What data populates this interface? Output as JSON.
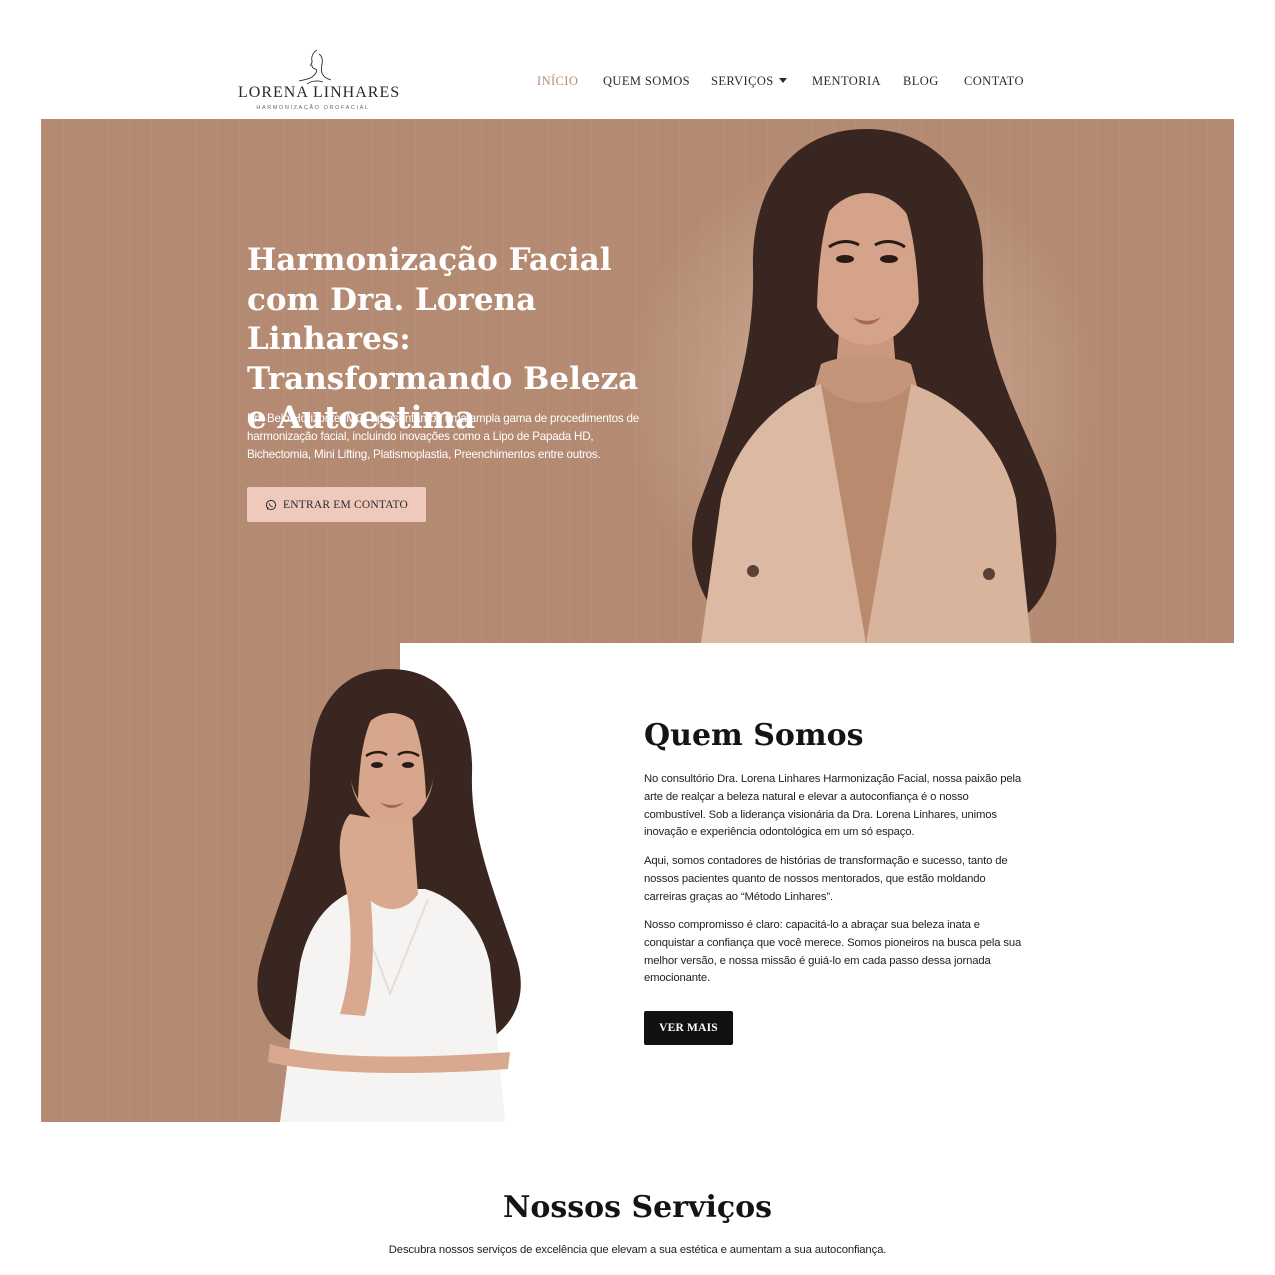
{
  "header": {
    "logo": {
      "name": "LORENA LINHARES",
      "tagline": "HARMONIZAÇÃO OROFACIAL",
      "icon": "face-line-art-logo"
    },
    "nav": [
      {
        "label": "INÍCIO",
        "active": true
      },
      {
        "label": "QUEM SOMOS",
        "active": false
      },
      {
        "label": "SERVIÇOS",
        "active": false,
        "has_dropdown": true
      },
      {
        "label": "MENTORIA",
        "active": false
      },
      {
        "label": "BLOG",
        "active": false
      },
      {
        "label": "CONTATO",
        "active": false
      }
    ]
  },
  "hero": {
    "title": "Harmonização Facial com Dra. Lorena Linhares: Transformando Beleza e Autoestima",
    "text": "Em Belo Horizonte, MG, apresentamos uma ampla gama de procedimentos de harmonização facial, incluindo inovações como a Lipo de Papada HD, Bichectomia, Mini Lifting, Platismoplastia, Preenchimentos entre outros.",
    "button_label": "ENTRAR EM CONTATO",
    "button_icon": "whatsapp-icon"
  },
  "about": {
    "title": "Quem Somos",
    "paragraphs": [
      "No consultório Dra. Lorena Linhares Harmonização Facial, nossa paixão pela arte de realçar a beleza natural e elevar a autoconfiança é o nosso combustível. Sob a liderança visionária da Dra. Lorena Linhares, unimos inovação e experiência odontológica em um só espaço.",
      "Aqui, somos contadores de histórias de transformação e sucesso, tanto de nossos pacientes quanto de nossos mentorados, que estão moldando carreiras graças ao “Método Linhares”.",
      "Nosso compromisso é claro: capacitá-lo a abraçar sua beleza inata e conquistar a confiança que você merece. Somos pioneiros na busca pela sua melhor versão, e nossa missão é guiá-lo em cada passo dessa jornada emocionante."
    ],
    "button_label": "VER MAIS"
  },
  "services": {
    "title": "Nossos Serviços",
    "subtitle": "Descubra nossos serviços de excelência que elevam a sua estética e aumentam a sua autoconfiança."
  },
  "colors": {
    "brand_tan": "#b48a72",
    "button_pink": "#f0c9bd",
    "nav_active": "#b98b6f",
    "dark_button": "#111111"
  }
}
